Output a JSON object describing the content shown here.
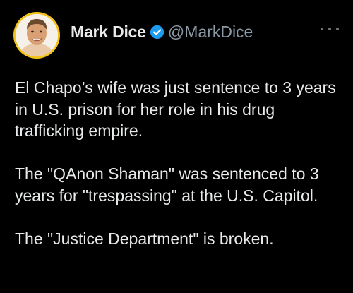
{
  "tweet": {
    "author": {
      "display_name": "Mark Dice",
      "handle": "@MarkDice",
      "verified": true,
      "avatar_icon": "user-avatar-photo",
      "avatar_ring_color": "#f2c21a"
    },
    "more_icon": "ellipsis-icon",
    "verified_color": "#1d9bf0",
    "paragraphs": [
      "El Chapo’s wife was just sentence to 3 years in U.S. prison for her role in his drug trafficking empire.",
      "The \"QAnon Shaman\" was sentenced to 3 years for \"trespassing\" at the U.S. Capitol.",
      "The \"Justice Department\" is broken."
    ]
  }
}
